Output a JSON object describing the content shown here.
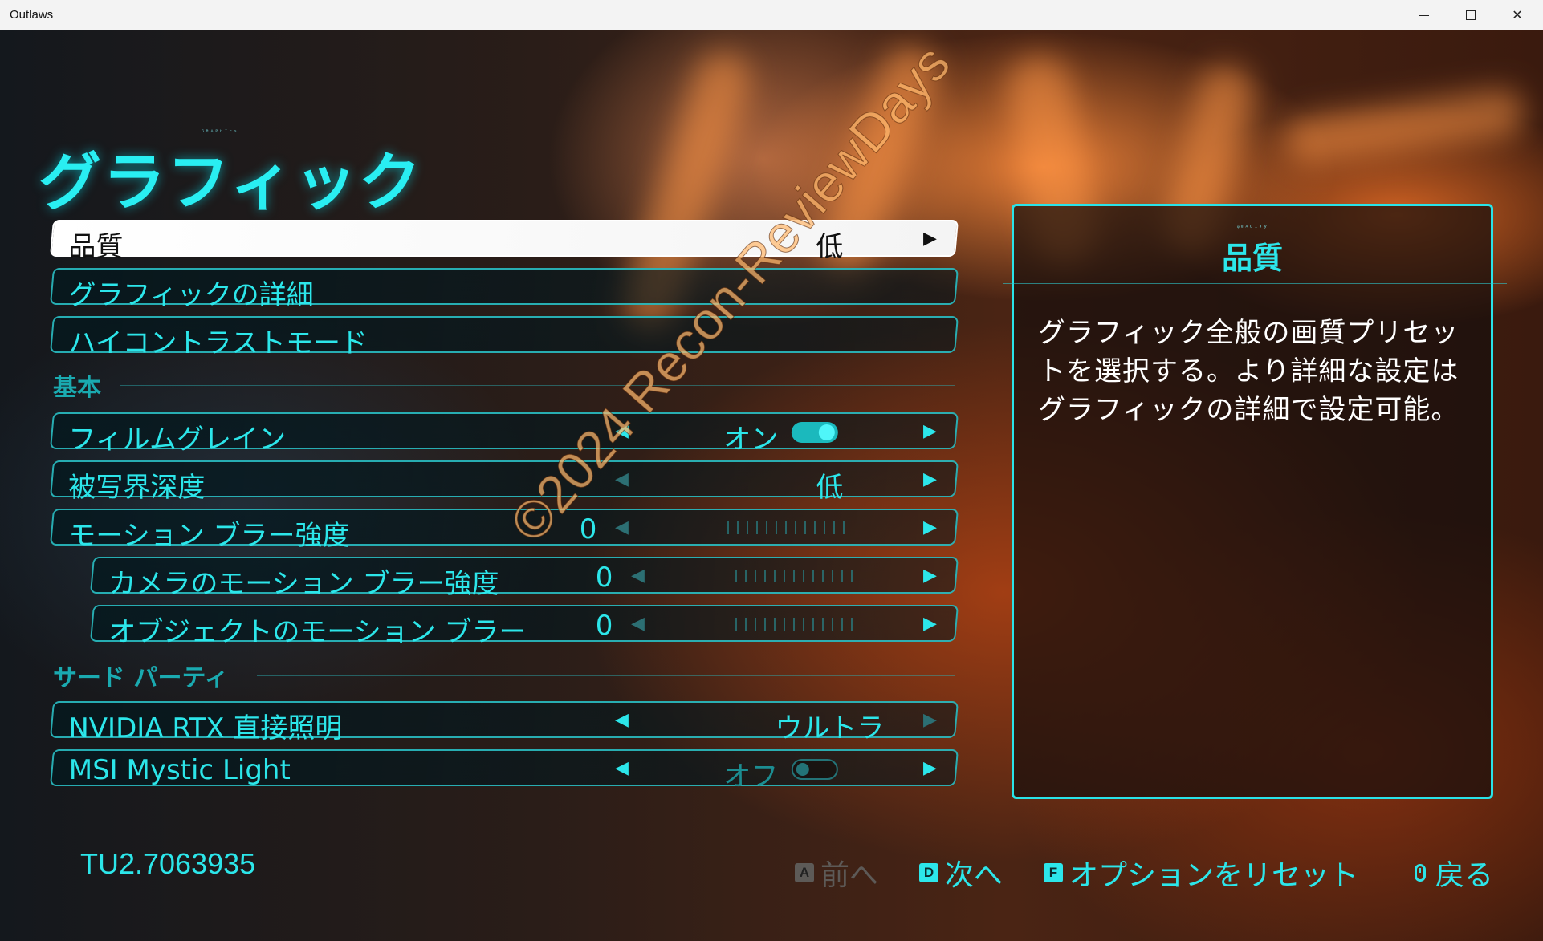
{
  "window": {
    "title": "Outlaws",
    "controls": [
      "minimize-icon",
      "maximize-icon",
      "close-icon"
    ]
  },
  "page": {
    "small_glyph_text": "ᴳᴿᴬᴾᴴᴵᶜˢ",
    "title": "グラフィック"
  },
  "settings": {
    "quality": {
      "label": "品質",
      "value": "低"
    },
    "graphics_detail": {
      "label": "グラフィックの詳細"
    },
    "high_contrast": {
      "label": "ハイコントラストモード"
    },
    "section_basic": "基本",
    "film_grain": {
      "label": "フィルムグレイン",
      "value": "オン",
      "enabled": true
    },
    "depth_of_field": {
      "label": "被写界深度",
      "value": "低"
    },
    "motion_blur": {
      "label": "モーション ブラー強度",
      "value": "0",
      "level": 0
    },
    "camera_motion_blur": {
      "label": "カメラのモーション ブラー強度",
      "value": "0",
      "level": 0
    },
    "object_motion_blur": {
      "label": "オブジェクトのモーション ブラー強度",
      "value": "0",
      "level": 0
    },
    "section_third_party": "サード パーティ",
    "rtx_gi": {
      "label": "NVIDIA RTX 直接照明",
      "value": "ウルトラ"
    },
    "msi_mystic": {
      "label": "MSI Mystic Light",
      "value": "オフ",
      "enabled": false
    }
  },
  "arrows": {
    "left": "◀",
    "right": "▶"
  },
  "version": "TU2.7063935",
  "info_panel": {
    "glyph": "ᵠᵘᴬᴸᴵᵀʸ",
    "title": "品質",
    "description": "グラフィック全般の画質プリセットを選択する。より詳細な設定はグラフィックの詳細で設定可能。"
  },
  "hints": [
    {
      "key": "A",
      "label": "前へ",
      "enabled": false
    },
    {
      "key": "D",
      "label": "次へ",
      "enabled": true
    },
    {
      "key": "F",
      "label": "オプションをリセット",
      "enabled": true
    },
    {
      "key": "mouse-icon",
      "label": "戻る",
      "enabled": true
    }
  ],
  "watermark": "©2024 Recon-ReviewDays",
  "colors": {
    "accent": "#2ce6ea",
    "selected_row": "#ffffff",
    "panel_border": "#29e3e8"
  }
}
